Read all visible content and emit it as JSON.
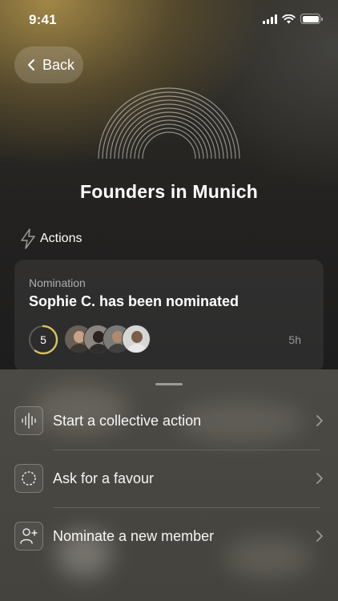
{
  "status_bar": {
    "time": "9:41",
    "icons": [
      "signal-icon",
      "wifi-icon",
      "battery-icon"
    ]
  },
  "header": {
    "back_label": "Back",
    "group_title": "Founders in Munich"
  },
  "actions_section": {
    "label": "Actions",
    "icon": "lightning-icon"
  },
  "nomination_card": {
    "type_label": "Nomination",
    "title": "Sophie C. has been nominated",
    "vote_count": "5",
    "vote_progress": 0.6,
    "time_ago": "5h",
    "avatar_count": 4
  },
  "action_sheet": {
    "items": [
      {
        "label": "Start a collective action",
        "icon": "waveform-icon"
      },
      {
        "label": "Ask for a favour",
        "icon": "dotted-circle-icon"
      },
      {
        "label": "Nominate a new member",
        "icon": "add-person-icon"
      }
    ]
  },
  "colors": {
    "accent_gold": "#d9c45a",
    "background": "#1c1c1c"
  }
}
